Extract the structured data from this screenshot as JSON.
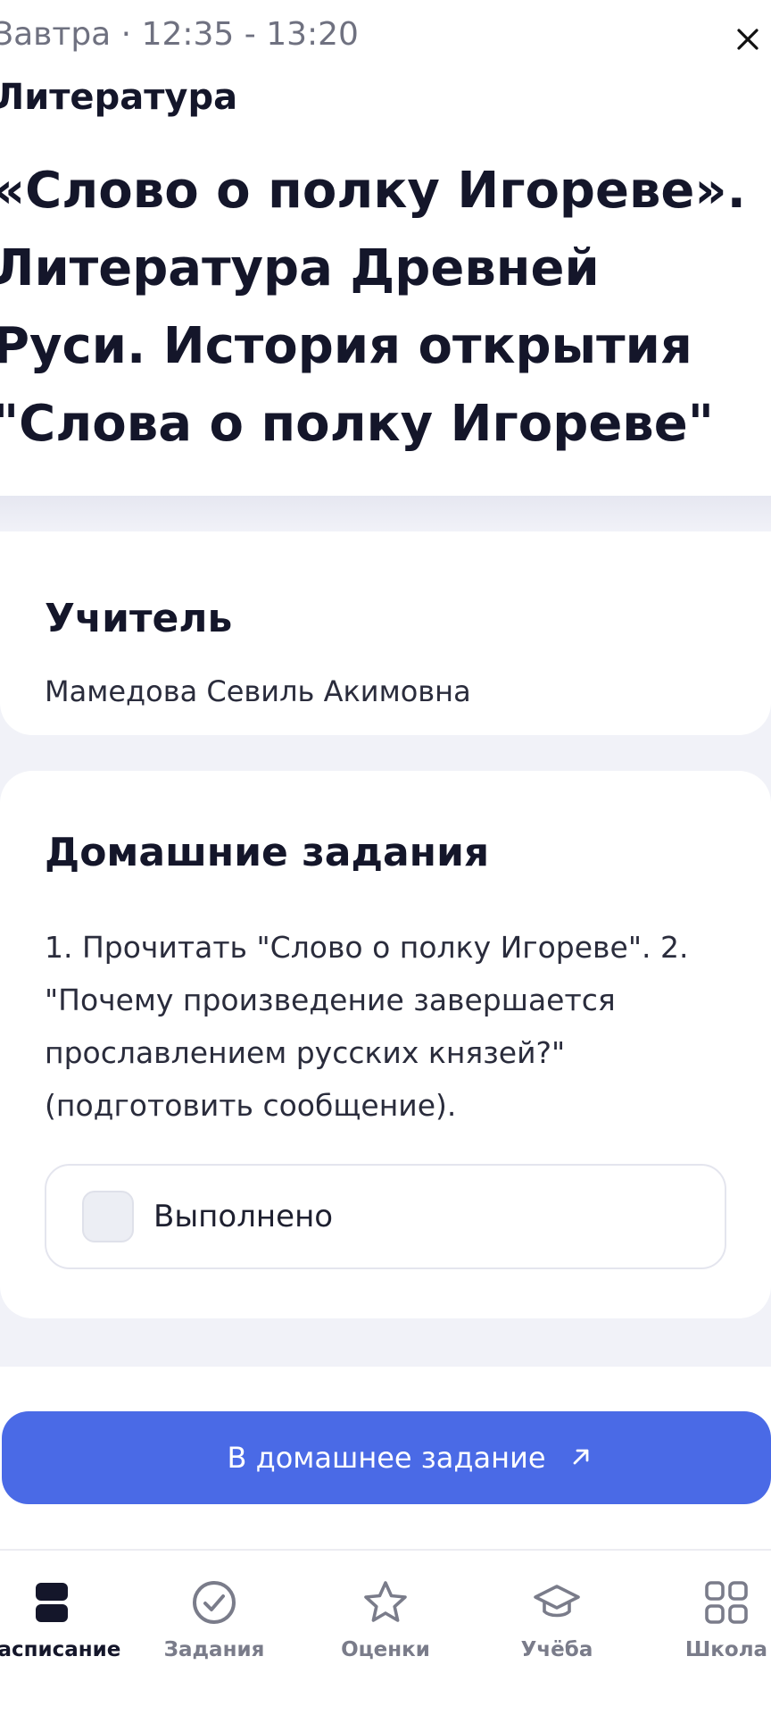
{
  "header": {
    "time": "Завтра · 12:35 - 13:20",
    "subject": "Литература",
    "lesson_title": "«Слово о полку Игореве». Литература Древней Руси. История открытия \"Слова о полку Игореве\"",
    "close_icon": "close-icon"
  },
  "teacher_card": {
    "heading": "Учитель",
    "name": "Мамедова Севиль Акимовна"
  },
  "homework_card": {
    "heading": "Домашние задания",
    "text": "1. Прочитать \"Слово о полку Игореве\". 2. \"Почему произведение завершается прославлением русских князей?\" (подготовить сообщение).",
    "done_label": "Выполнено",
    "done_checked": false
  },
  "action_button": {
    "label": "В домашнее задание",
    "icon": "arrow-up-right-icon",
    "color": "#4a6ae6"
  },
  "bottom_nav": {
    "items": [
      {
        "label": "Расписание",
        "icon": "schedule-icon",
        "active": true
      },
      {
        "label": "Задания",
        "icon": "check-circle-icon",
        "active": false
      },
      {
        "label": "Оценки",
        "icon": "star-icon",
        "active": false
      },
      {
        "label": "Учёба",
        "icon": "graduation-cap-icon",
        "active": false
      },
      {
        "label": "Школа",
        "icon": "grid-icon",
        "active": false
      }
    ]
  }
}
